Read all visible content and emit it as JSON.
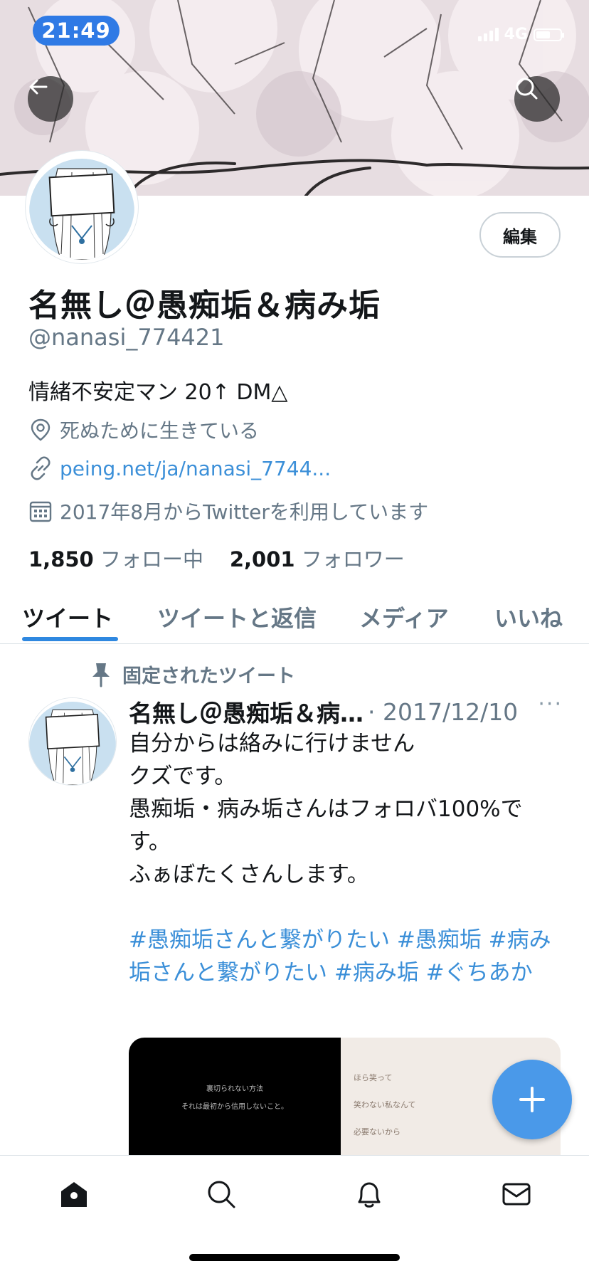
{
  "status_bar": {
    "time": "21:49",
    "network": "4G",
    "battery_level": 0.6
  },
  "profile": {
    "edit_label": "編集",
    "display_name": "名無し＠愚痴垢＆病み垢",
    "handle": "@nanasi_774421",
    "bio": "情緒不安定マン 20↑ DM△",
    "location": "死ぬために生きている",
    "link": "peing.net/ja/nanasi_7744...",
    "joined": "2017年8月からTwitterを利用しています",
    "following_count": "1,850",
    "following_label": "フォロー中",
    "followers_count": "2,001",
    "followers_label": "フォロワー"
  },
  "tabs": [
    {
      "label": "ツイート",
      "active": true
    },
    {
      "label": "ツイートと返信",
      "active": false
    },
    {
      "label": "メディア",
      "active": false
    },
    {
      "label": "いいね",
      "active": false
    }
  ],
  "pinned_tweet": {
    "pinned_label": "固定されたツイート",
    "author": "名無し＠愚痴垢＆病…",
    "date": "· 2017/12/10",
    "more": "···",
    "lines": [
      "自分からは絡みに行けません",
      "クズです。",
      "愚痴垢・病み垢さんはフォロバ100%です。",
      "ふぁぼたくさんします。"
    ],
    "hashtags": "#愚痴垢さんと繋がりたい #愚痴垢 #病み垢さんと繋がりたい #病み垢 #ぐちあか",
    "media": {
      "left_lines": [
        "裏切られない方法",
        "それは最初から信用しないこと。"
      ],
      "right_lines": [
        "ほら笑って",
        "笑わない私なんて",
        "必要ないから"
      ]
    }
  },
  "colors": {
    "accent": "#2f88e0",
    "link": "#3b8fd8",
    "secondary_text": "#657786",
    "fab": "#4a99e9"
  },
  "icons": {
    "back": "arrow-left-icon",
    "search": "search-icon",
    "location": "location-pin-icon",
    "link": "link-icon",
    "calendar": "calendar-icon",
    "pin": "pin-icon",
    "fab": "plus-icon",
    "nav": [
      "home-icon",
      "search-icon",
      "bell-icon",
      "mail-icon"
    ]
  }
}
